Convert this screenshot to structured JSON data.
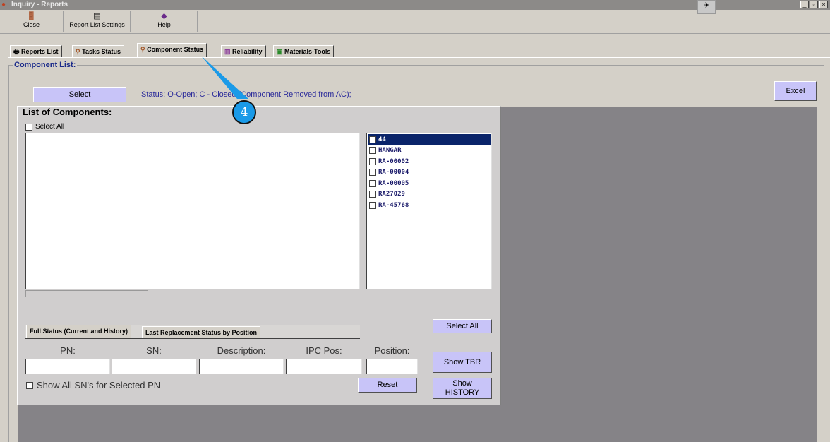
{
  "window": {
    "title": "Inquiry - Reports",
    "controls": [
      "_",
      "▫",
      "×"
    ]
  },
  "toolbar": {
    "close": "Close",
    "report_list_settings": "Report List Settings",
    "help": "Help"
  },
  "tabs": [
    {
      "label": "Reports List"
    },
    {
      "label": "Tasks Status"
    },
    {
      "label": "Component Status"
    },
    {
      "label": "Reliability"
    },
    {
      "label": "Materials-Tools"
    }
  ],
  "component_list": {
    "title": "Component List:",
    "select": "Select",
    "status_text": "Status: O-Open; C - Closed (Component Removed from AC);",
    "excel": "Excel"
  },
  "list_of_components": {
    "title": "List of Components:",
    "select_all_checkbox": "Select All",
    "items": [
      {
        "label": "44",
        "selected": true
      },
      {
        "label": "HANGAR"
      },
      {
        "label": "RA-00002"
      },
      {
        "label": "RA-00004"
      },
      {
        "label": "RA-00005"
      },
      {
        "label": "RA27029"
      },
      {
        "label": "RA-45768"
      }
    ],
    "select_all_button": "Select All"
  },
  "subtabs": [
    {
      "label": "Full Status (Current and History)"
    },
    {
      "label": "Last Replacement Status by Position"
    }
  ],
  "filters": {
    "pn": "PN:",
    "sn": "SN:",
    "description": "Description:",
    "ipc_pos": "IPC Pos:",
    "position": "Position:"
  },
  "show_all_sns": "Show All SN's for Selected PN",
  "buttons": {
    "show_tbr": "Show TBR",
    "show_history": "Show HISTORY",
    "reset": "Reset"
  },
  "callout": {
    "number": "4"
  }
}
